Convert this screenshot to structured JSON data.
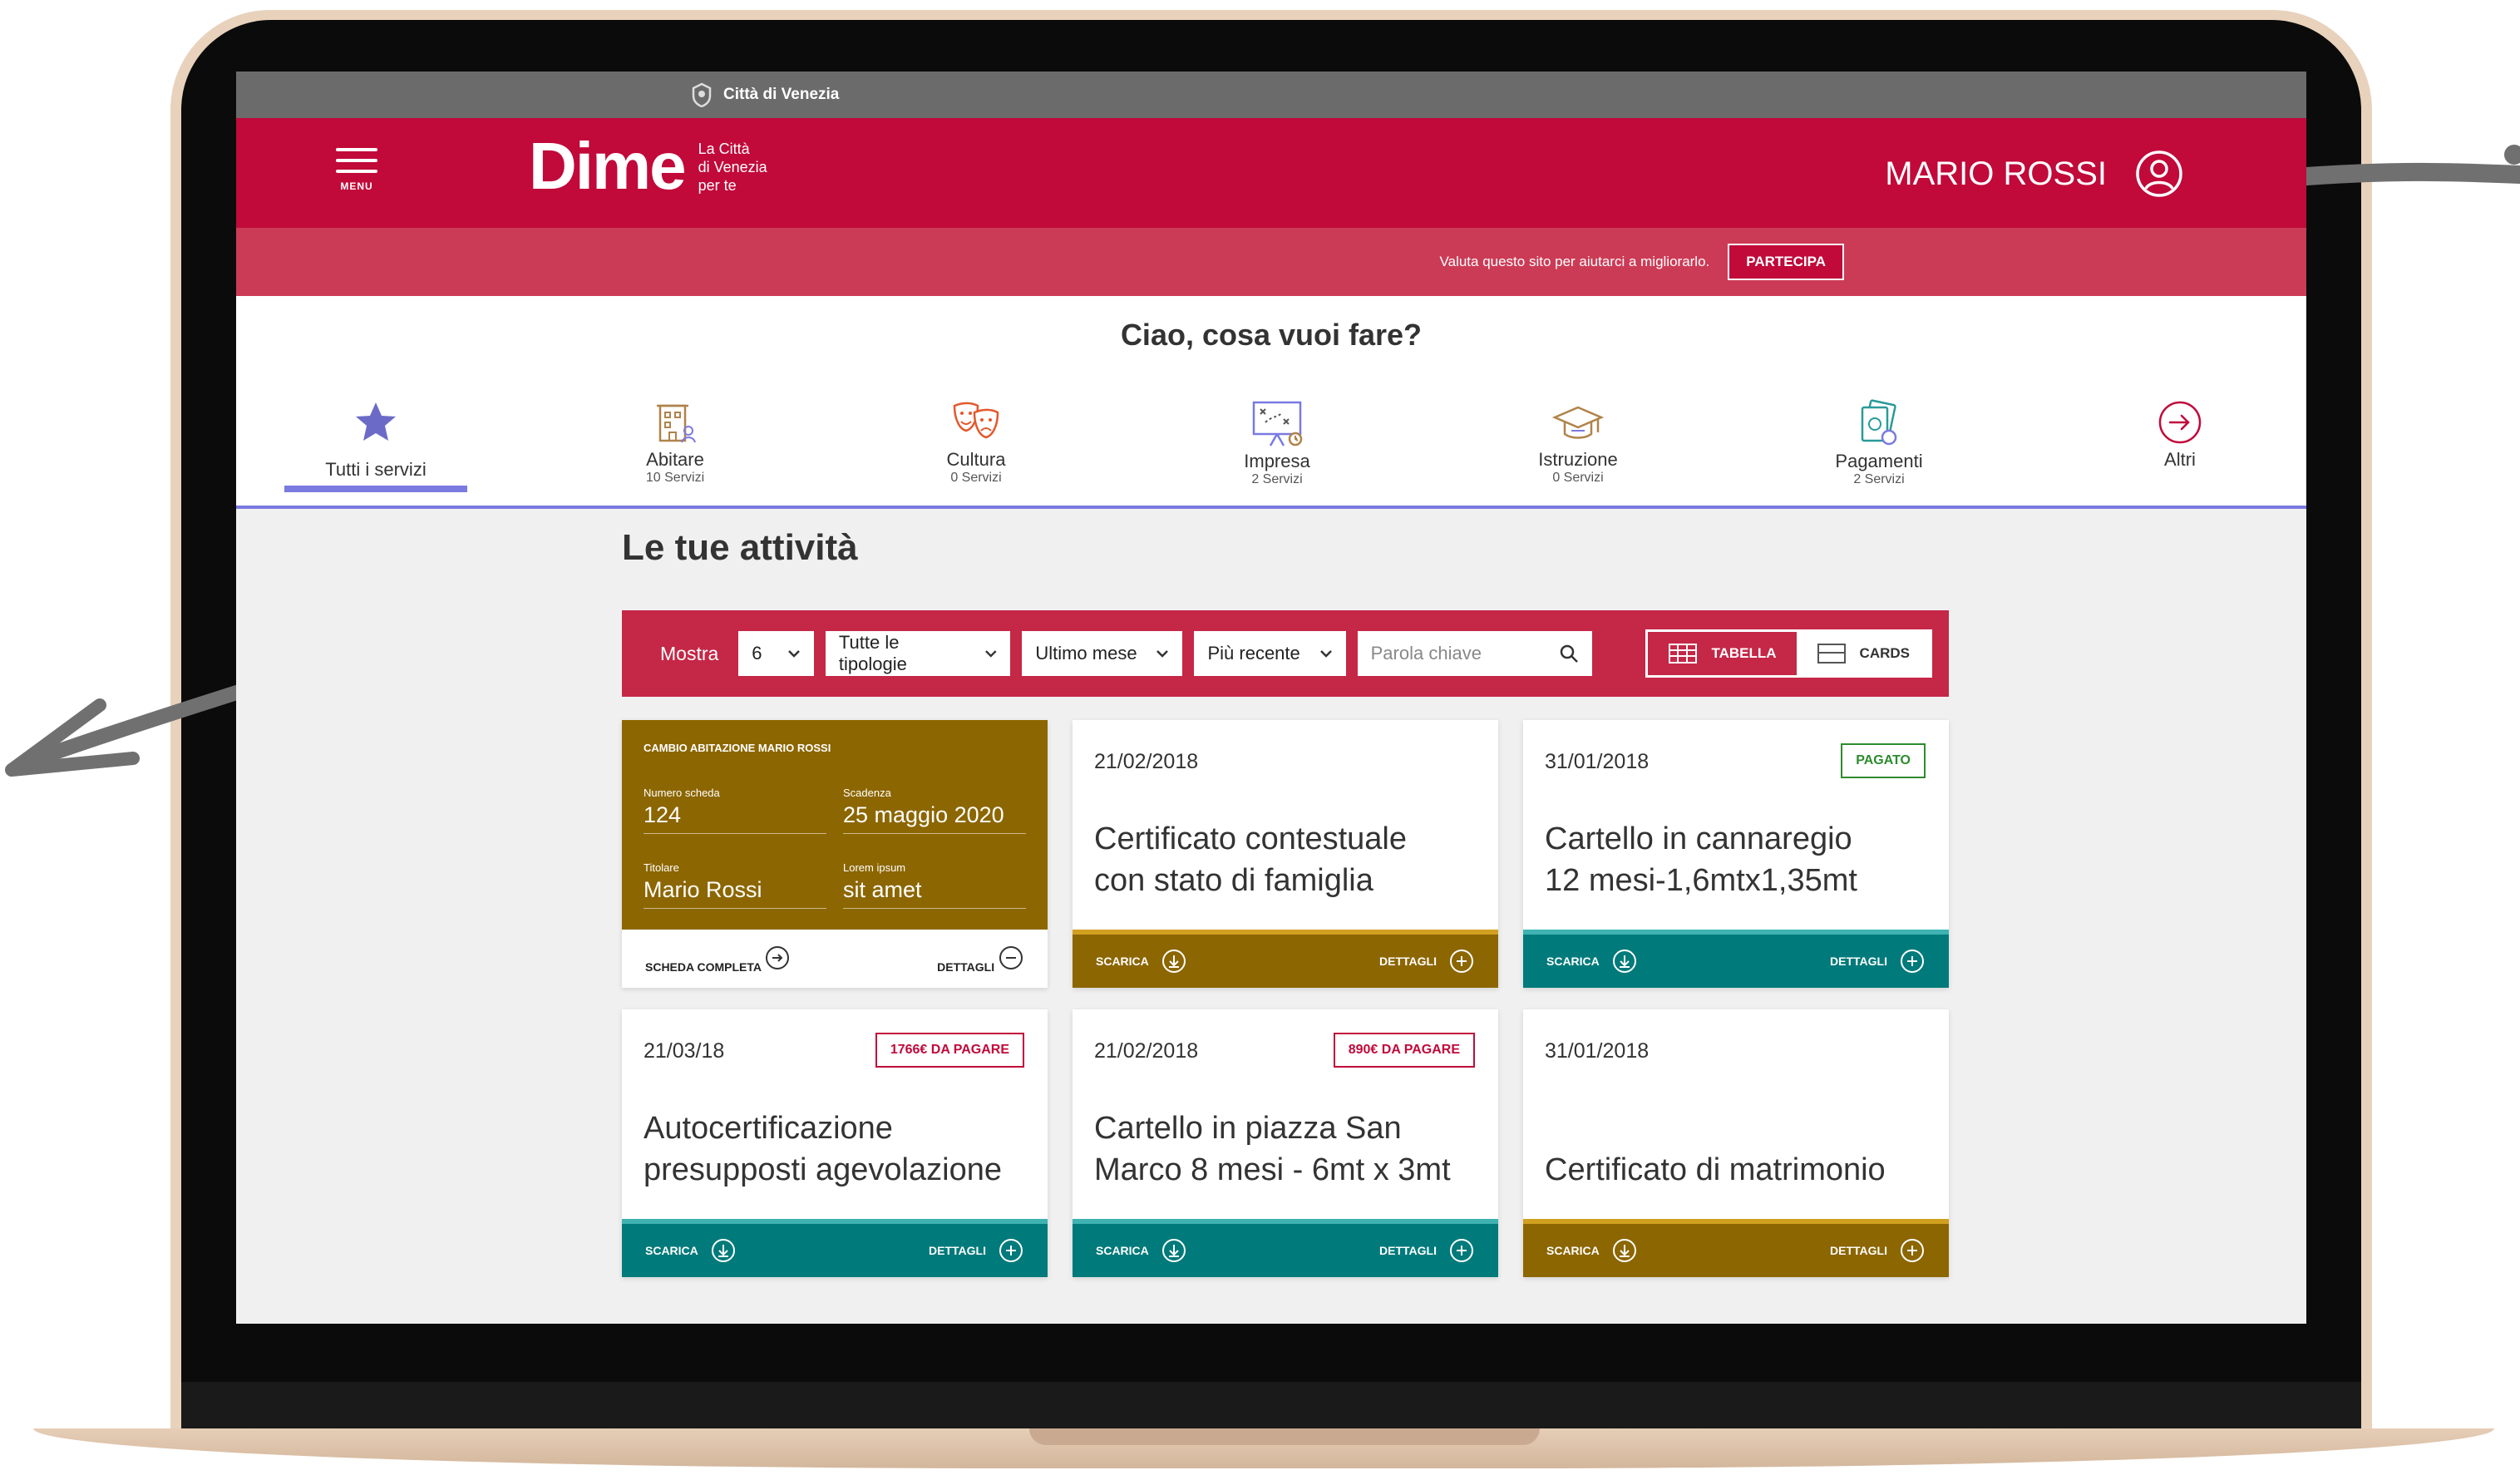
{
  "city": {
    "name": "Città di Venezia"
  },
  "header": {
    "menu_label": "MENU",
    "logo_word": "Dime",
    "logo_tagline": [
      "La Città",
      "di Venezia",
      "per te"
    ],
    "user_name": "MARIO ROSSI"
  },
  "feedback": {
    "text": "Valuta questo sito per aiutarci a migliorarlo.",
    "button": "PARTECIPA"
  },
  "greeting": "Ciao, cosa vuoi fare?",
  "categories": [
    {
      "name": "Tutti i servizi",
      "count": "",
      "icon": "star-icon"
    },
    {
      "name": "Abitare",
      "count": "10 Servizi",
      "icon": "building-icon"
    },
    {
      "name": "Cultura",
      "count": "0 Servizi",
      "icon": "theater-masks-icon"
    },
    {
      "name": "Impresa",
      "count": "2 Servizi",
      "icon": "strategy-board-icon"
    },
    {
      "name": "Istruzione",
      "count": "0 Servizi",
      "icon": "graduation-cap-icon"
    },
    {
      "name": "Pagamenti",
      "count": "2 Servizi",
      "icon": "money-icon"
    },
    {
      "name": "Altri",
      "count": "",
      "icon": "arrow-circle-icon"
    }
  ],
  "activities_title": "Le tue attività",
  "filters": {
    "mostra_label": "Mostra",
    "count": "6",
    "type": "Tutte le tipologie",
    "period": "Ultimo mese",
    "sort": "Più recente",
    "search_placeholder": "Parola chiave",
    "view_table": "TABELLA",
    "view_cards": "CARDS"
  },
  "featured_card": {
    "heading": "CAMBIO ABITAZIONE MARIO ROSSI",
    "numero_label": "Numero scheda",
    "numero_value": "124",
    "scadenza_label": "Scadenza",
    "scadenza_value": "25 maggio 2020",
    "titolare_label": "Titolare",
    "titolare_value": "Mario Rossi",
    "lorem_label": "Lorem ipsum",
    "lorem_value": "sit amet",
    "link_full": "SCHEDA COMPLETA",
    "link_details": "DETTAGLI"
  },
  "cards": [
    {
      "date": "21/02/2018",
      "badge": "",
      "title": [
        "Certificato contestuale",
        "con stato di famiglia"
      ],
      "scarica": "SCARICA",
      "dettagli": "DETTAGLI"
    },
    {
      "date": "31/01/2018",
      "badge": "PAGATO",
      "title": [
        "Cartello in cannaregio",
        "12 mesi-1,6mtx1,35mt"
      ],
      "scarica": "SCARICA",
      "dettagli": "DETTAGLI"
    },
    {
      "date": "21/03/18",
      "badge": "1766€ DA PAGARE",
      "title": [
        "Autocertificazione",
        "presupposti agevolazione"
      ],
      "scarica": "SCARICA",
      "dettagli": "DETTAGLI"
    },
    {
      "date": "21/02/2018",
      "badge": "890€ DA PAGARE",
      "title": [
        "Cartello in piazza San",
        "Marco 8 mesi - 6mt x 3mt"
      ],
      "scarica": "SCARICA",
      "dettagli": "DETTAGLI"
    },
    {
      "date": "31/01/2018",
      "badge": "",
      "title": [
        "Certificato di matrimonio"
      ],
      "scarica": "SCARICA",
      "dettagli": "DETTAGLI"
    }
  ],
  "colors": {
    "brand_red": "#c1093a",
    "feedback_red": "#cc3b56",
    "filter_red": "#c52747",
    "olive": "#8c6600",
    "teal": "#007a7a",
    "accent_purple": "#7a7ae0",
    "paid_green": "#2e8b2e"
  }
}
